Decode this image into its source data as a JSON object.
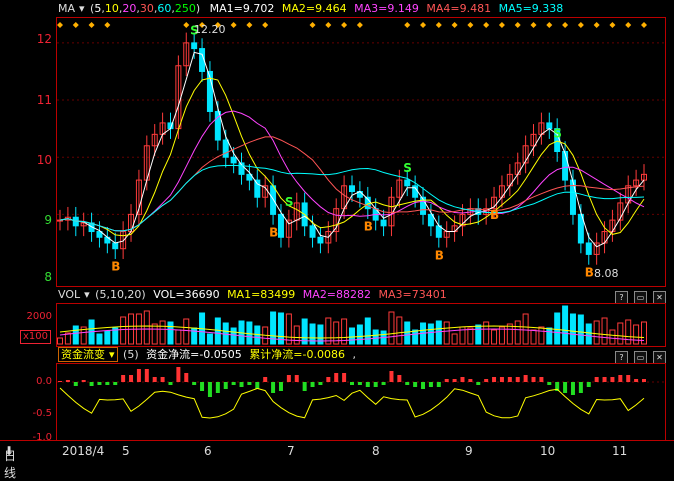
{
  "main_header": {
    "indicator": "MA",
    "params_open": "(",
    "p1": "5",
    "p2": "10",
    "p3": "20",
    "p4": "30",
    "p5": "60",
    "p6": "250",
    "params_close": ")",
    "ma1": "MA1=9.702",
    "ma2": "MA2=9.464",
    "ma3": "MA3=9.149",
    "ma4": "MA4=9.481",
    "ma5": "MA5=9.338",
    "colors": {
      "ma1": "#ffffff",
      "ma2": "#ffff00",
      "ma3": "#ff44ff",
      "ma4": "#ff5555",
      "ma5": "#00ffff"
    }
  },
  "price_axis": [
    "12",
    "11",
    "10",
    "9",
    "8"
  ],
  "annotations": {
    "high": "12.20",
    "low": "8.08",
    "buy": "B",
    "sell": "S"
  },
  "vol_header": {
    "indicator": "VOL",
    "params": "(5,10,20)",
    "vol": "VOL=36690",
    "ma1": "MA1=83499",
    "ma2": "MA2=88282",
    "ma3": "MA3=73401"
  },
  "vol_axis": {
    "top": "2000",
    "unit": "x100"
  },
  "flow_header": {
    "indicator": "资金流变",
    "params": "(5)",
    "net": "资金净流=-0.0505",
    "cum": "累计净流=-0.0086",
    "comma": ","
  },
  "flow_axis": [
    "0.0",
    "-0.5",
    "-1.0"
  ],
  "time_axis": {
    "period": "日线",
    "labels": [
      "2018/4",
      "5",
      "6",
      "7",
      "8",
      "9",
      "10",
      "11"
    ]
  },
  "chart_data": {
    "type": "line",
    "ylim": [
      7.8,
      12.4
    ],
    "close": [
      8.9,
      8.95,
      8.8,
      8.85,
      8.7,
      8.6,
      8.5,
      8.4,
      8.7,
      9.0,
      9.6,
      10.2,
      10.4,
      10.6,
      10.5,
      11.6,
      12.0,
      11.9,
      11.5,
      10.8,
      10.3,
      10.0,
      9.9,
      9.7,
      9.6,
      9.3,
      9.5,
      9.0,
      8.6,
      8.9,
      9.2,
      8.8,
      8.6,
      8.5,
      8.7,
      9.1,
      9.5,
      9.4,
      9.3,
      9.1,
      8.9,
      8.8,
      9.3,
      9.6,
      9.5,
      9.3,
      9.0,
      8.8,
      8.6,
      8.7,
      8.8,
      9.0,
      9.1,
      9.0,
      9.1,
      9.3,
      9.5,
      9.7,
      9.9,
      10.2,
      10.4,
      10.6,
      10.5,
      10.1,
      9.6,
      9.0,
      8.5,
      8.3,
      8.5,
      8.7,
      8.9,
      9.2,
      9.5,
      9.6,
      9.7
    ]
  }
}
